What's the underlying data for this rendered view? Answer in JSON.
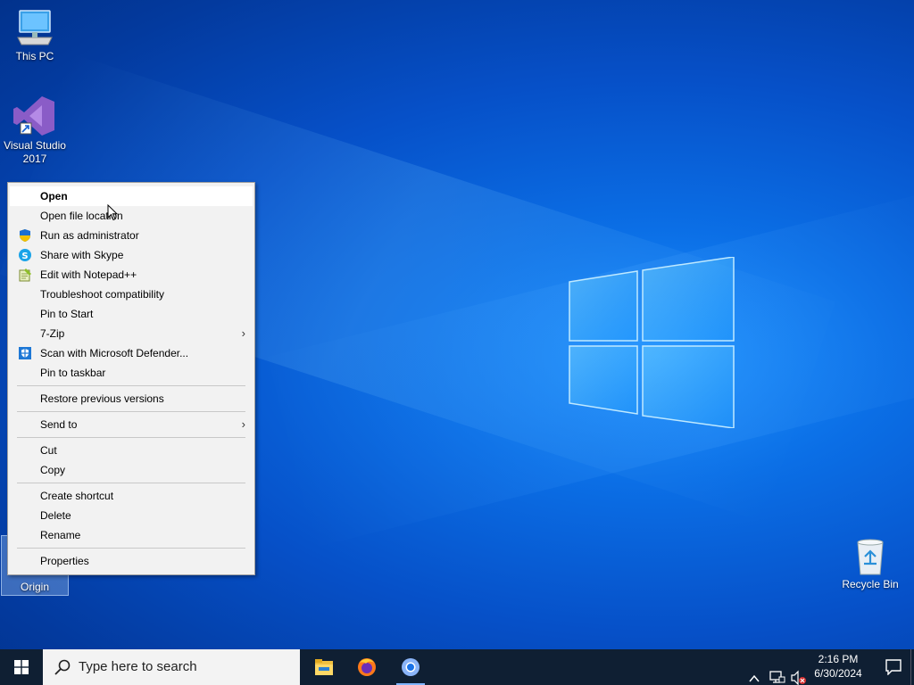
{
  "desktop": {
    "icons": {
      "this_pc": "This PC",
      "visual_studio_line1": "Visual Studio",
      "visual_studio_line2": "2017",
      "origin": "Origin",
      "recycle_bin": "Recycle Bin"
    }
  },
  "context_menu": {
    "items": [
      {
        "label": "Open",
        "icon": null
      },
      {
        "label": "Open file location",
        "icon": null
      },
      {
        "label": "Run as administrator",
        "icon": "shield-icon"
      },
      {
        "label": "Share with Skype",
        "icon": "skype-icon"
      },
      {
        "label": "Edit with Notepad++",
        "icon": "notepad-plus-plus-icon"
      },
      {
        "label": "Troubleshoot compatibility",
        "icon": null
      },
      {
        "label": "Pin to Start",
        "icon": null
      },
      {
        "label": "7-Zip",
        "icon": null,
        "submenu": true
      },
      {
        "label": "Scan with Microsoft Defender...",
        "icon": "defender-icon"
      },
      {
        "label": "Pin to taskbar",
        "icon": null
      },
      {
        "label": "Restore previous versions",
        "icon": null
      },
      {
        "label": "Send to",
        "icon": null,
        "submenu": true
      },
      {
        "label": "Cut",
        "icon": null
      },
      {
        "label": "Copy",
        "icon": null
      },
      {
        "label": "Create shortcut",
        "icon": null
      },
      {
        "label": "Delete",
        "icon": null
      },
      {
        "label": "Rename",
        "icon": null
      },
      {
        "label": "Properties",
        "icon": null
      }
    ],
    "submenu_arrow": "›"
  },
  "taskbar": {
    "search_placeholder": "Type here to search",
    "apps": [
      "file-explorer-icon",
      "firefox-icon",
      "chrome-icon"
    ],
    "tray": {
      "time": "2:16 PM",
      "date": "6/30/2024"
    }
  },
  "colors": {
    "taskbar_bg": "#0f1f33",
    "menu_bg": "#f2f2f2",
    "desktop_accent": "#0b6fe6"
  }
}
